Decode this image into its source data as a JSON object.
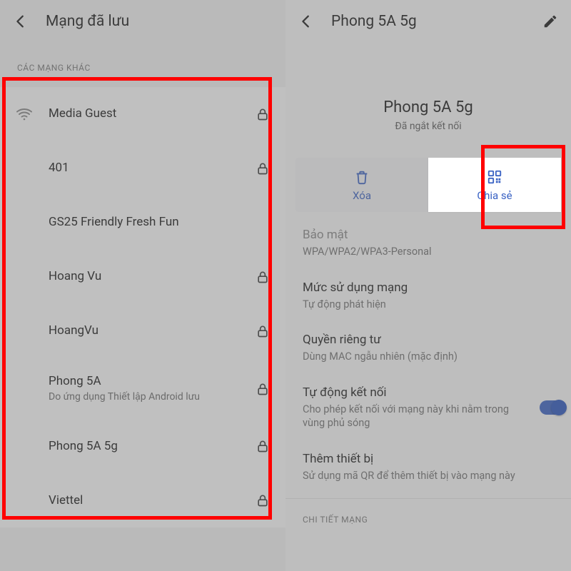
{
  "left": {
    "header_title": "Mạng đã lưu",
    "subhead": "CÁC MẠNG KHÁC",
    "networks": [
      {
        "name": "Media Guest",
        "subtitle": "",
        "locked": true,
        "show_wifi_icon": true
      },
      {
        "name": "401",
        "subtitle": "",
        "locked": true,
        "show_wifi_icon": false
      },
      {
        "name": "GS25 Friendly Fresh Fun",
        "subtitle": "",
        "locked": false,
        "show_wifi_icon": false
      },
      {
        "name": "Hoang Vu",
        "subtitle": "",
        "locked": true,
        "show_wifi_icon": false
      },
      {
        "name": "HoangVu",
        "subtitle": "",
        "locked": true,
        "show_wifi_icon": false
      },
      {
        "name": "Phong 5A",
        "subtitle": "Do ứng dụng Thiết lập Android lưu",
        "locked": true,
        "show_wifi_icon": false
      },
      {
        "name": "Phong 5A 5g",
        "subtitle": "",
        "locked": true,
        "show_wifi_icon": false
      },
      {
        "name": "Viettel",
        "subtitle": "",
        "locked": true,
        "show_wifi_icon": false
      }
    ]
  },
  "right": {
    "header_title": "Phong 5A 5g",
    "network_name": "Phong 5A 5g",
    "status": "Đã ngắt kết nối",
    "actions": {
      "delete": "Xóa",
      "share": "Chia sẻ"
    },
    "details": {
      "security_label": "Bảo mật",
      "security_value": "WPA/WPA2/WPA3-Personal",
      "usage_label": "Mức sử dụng mạng",
      "usage_value": "Tự động phát hiện",
      "privacy_label": "Quyền riêng tư",
      "privacy_value": "Dùng MAC ngẫu nhiên (mặc định)",
      "autoconnect_label": "Tự động kết nối",
      "autoconnect_value": "Cho phép kết nối với mạng này khi nằm trong vùng phủ sóng",
      "adddevice_label": "Thêm thiết bị",
      "adddevice_value": "Sử dụng mã QR để thêm thiết bị vào mạng này",
      "section_detail": "CHI TIẾT MẠNG"
    }
  },
  "colors": {
    "accent": "#3b63c4",
    "highlight": "#ff0000"
  }
}
